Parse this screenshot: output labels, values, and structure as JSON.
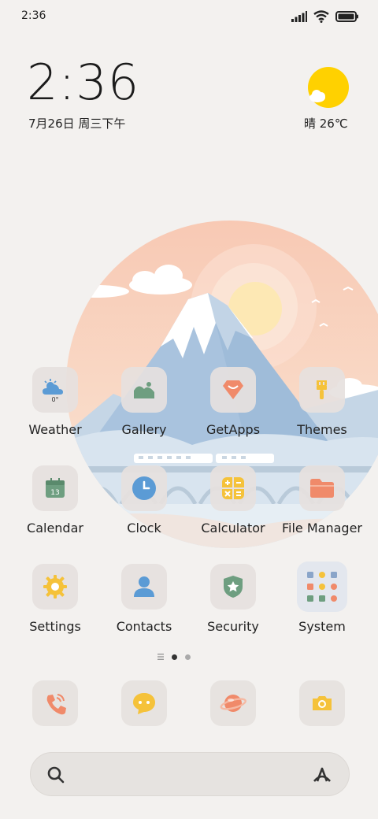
{
  "status_bar": {
    "time": "2:36",
    "icons": [
      "signal-icon",
      "wifi-icon",
      "battery-icon"
    ]
  },
  "clock_widget": {
    "time": "2:36",
    "date": "7月26日 周三下午"
  },
  "weather_widget": {
    "icon": "sun-cloud-icon",
    "summary": "晴 26℃"
  },
  "apps": [
    {
      "label": "Weather",
      "icon": "weather-icon",
      "badge": "0°"
    },
    {
      "label": "Gallery",
      "icon": "gallery-icon"
    },
    {
      "label": "GetApps",
      "icon": "getapps-icon"
    },
    {
      "label": "Themes",
      "icon": "themes-brush-icon"
    },
    {
      "label": "Calendar",
      "icon": "calendar-icon",
      "badge": "13"
    },
    {
      "label": "Clock",
      "icon": "clock-icon"
    },
    {
      "label": "Calculator",
      "icon": "calculator-icon"
    },
    {
      "label": "File Manager",
      "icon": "folder-icon"
    },
    {
      "label": "Settings",
      "icon": "gear-icon"
    },
    {
      "label": "Contacts",
      "icon": "person-icon"
    },
    {
      "label": "Security",
      "icon": "shield-icon"
    },
    {
      "label": "System",
      "icon": "folder-grid-icon"
    }
  ],
  "dock": [
    {
      "icon": "phone-icon"
    },
    {
      "icon": "messages-icon"
    },
    {
      "icon": "browser-planet-icon"
    },
    {
      "icon": "camera-icon"
    }
  ],
  "page_indicator": {
    "pages": 2,
    "current": 1
  },
  "search": {
    "placeholder": "",
    "value": ""
  },
  "colors": {
    "background": "#f3f1ef",
    "sun": "#ffd100",
    "accent_orange": "#f59a7a",
    "accent_yellow": "#f5c23a",
    "accent_blue": "#5b9bd5",
    "accent_green": "#6e9e80"
  }
}
